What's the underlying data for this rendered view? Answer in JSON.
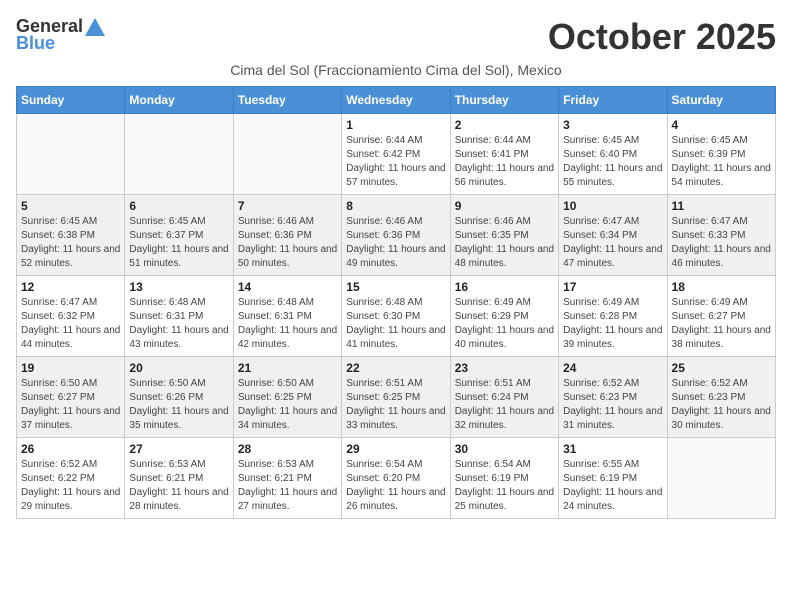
{
  "logo": {
    "general": "General",
    "blue": "Blue"
  },
  "title": "October 2025",
  "subtitle": "Cima del Sol (Fraccionamiento Cima del Sol), Mexico",
  "days_of_week": [
    "Sunday",
    "Monday",
    "Tuesday",
    "Wednesday",
    "Thursday",
    "Friday",
    "Saturday"
  ],
  "weeks": [
    [
      {
        "day": "",
        "info": ""
      },
      {
        "day": "",
        "info": ""
      },
      {
        "day": "",
        "info": ""
      },
      {
        "day": "1",
        "info": "Sunrise: 6:44 AM\nSunset: 6:42 PM\nDaylight: 11 hours and 57 minutes."
      },
      {
        "day": "2",
        "info": "Sunrise: 6:44 AM\nSunset: 6:41 PM\nDaylight: 11 hours and 56 minutes."
      },
      {
        "day": "3",
        "info": "Sunrise: 6:45 AM\nSunset: 6:40 PM\nDaylight: 11 hours and 55 minutes."
      },
      {
        "day": "4",
        "info": "Sunrise: 6:45 AM\nSunset: 6:39 PM\nDaylight: 11 hours and 54 minutes."
      }
    ],
    [
      {
        "day": "5",
        "info": "Sunrise: 6:45 AM\nSunset: 6:38 PM\nDaylight: 11 hours and 52 minutes."
      },
      {
        "day": "6",
        "info": "Sunrise: 6:45 AM\nSunset: 6:37 PM\nDaylight: 11 hours and 51 minutes."
      },
      {
        "day": "7",
        "info": "Sunrise: 6:46 AM\nSunset: 6:36 PM\nDaylight: 11 hours and 50 minutes."
      },
      {
        "day": "8",
        "info": "Sunrise: 6:46 AM\nSunset: 6:36 PM\nDaylight: 11 hours and 49 minutes."
      },
      {
        "day": "9",
        "info": "Sunrise: 6:46 AM\nSunset: 6:35 PM\nDaylight: 11 hours and 48 minutes."
      },
      {
        "day": "10",
        "info": "Sunrise: 6:47 AM\nSunset: 6:34 PM\nDaylight: 11 hours and 47 minutes."
      },
      {
        "day": "11",
        "info": "Sunrise: 6:47 AM\nSunset: 6:33 PM\nDaylight: 11 hours and 46 minutes."
      }
    ],
    [
      {
        "day": "12",
        "info": "Sunrise: 6:47 AM\nSunset: 6:32 PM\nDaylight: 11 hours and 44 minutes."
      },
      {
        "day": "13",
        "info": "Sunrise: 6:48 AM\nSunset: 6:31 PM\nDaylight: 11 hours and 43 minutes."
      },
      {
        "day": "14",
        "info": "Sunrise: 6:48 AM\nSunset: 6:31 PM\nDaylight: 11 hours and 42 minutes."
      },
      {
        "day": "15",
        "info": "Sunrise: 6:48 AM\nSunset: 6:30 PM\nDaylight: 11 hours and 41 minutes."
      },
      {
        "day": "16",
        "info": "Sunrise: 6:49 AM\nSunset: 6:29 PM\nDaylight: 11 hours and 40 minutes."
      },
      {
        "day": "17",
        "info": "Sunrise: 6:49 AM\nSunset: 6:28 PM\nDaylight: 11 hours and 39 minutes."
      },
      {
        "day": "18",
        "info": "Sunrise: 6:49 AM\nSunset: 6:27 PM\nDaylight: 11 hours and 38 minutes."
      }
    ],
    [
      {
        "day": "19",
        "info": "Sunrise: 6:50 AM\nSunset: 6:27 PM\nDaylight: 11 hours and 37 minutes."
      },
      {
        "day": "20",
        "info": "Sunrise: 6:50 AM\nSunset: 6:26 PM\nDaylight: 11 hours and 35 minutes."
      },
      {
        "day": "21",
        "info": "Sunrise: 6:50 AM\nSunset: 6:25 PM\nDaylight: 11 hours and 34 minutes."
      },
      {
        "day": "22",
        "info": "Sunrise: 6:51 AM\nSunset: 6:25 PM\nDaylight: 11 hours and 33 minutes."
      },
      {
        "day": "23",
        "info": "Sunrise: 6:51 AM\nSunset: 6:24 PM\nDaylight: 11 hours and 32 minutes."
      },
      {
        "day": "24",
        "info": "Sunrise: 6:52 AM\nSunset: 6:23 PM\nDaylight: 11 hours and 31 minutes."
      },
      {
        "day": "25",
        "info": "Sunrise: 6:52 AM\nSunset: 6:23 PM\nDaylight: 11 hours and 30 minutes."
      }
    ],
    [
      {
        "day": "26",
        "info": "Sunrise: 6:52 AM\nSunset: 6:22 PM\nDaylight: 11 hours and 29 minutes."
      },
      {
        "day": "27",
        "info": "Sunrise: 6:53 AM\nSunset: 6:21 PM\nDaylight: 11 hours and 28 minutes."
      },
      {
        "day": "28",
        "info": "Sunrise: 6:53 AM\nSunset: 6:21 PM\nDaylight: 11 hours and 27 minutes."
      },
      {
        "day": "29",
        "info": "Sunrise: 6:54 AM\nSunset: 6:20 PM\nDaylight: 11 hours and 26 minutes."
      },
      {
        "day": "30",
        "info": "Sunrise: 6:54 AM\nSunset: 6:19 PM\nDaylight: 11 hours and 25 minutes."
      },
      {
        "day": "31",
        "info": "Sunrise: 6:55 AM\nSunset: 6:19 PM\nDaylight: 11 hours and 24 minutes."
      },
      {
        "day": "",
        "info": ""
      }
    ]
  ]
}
